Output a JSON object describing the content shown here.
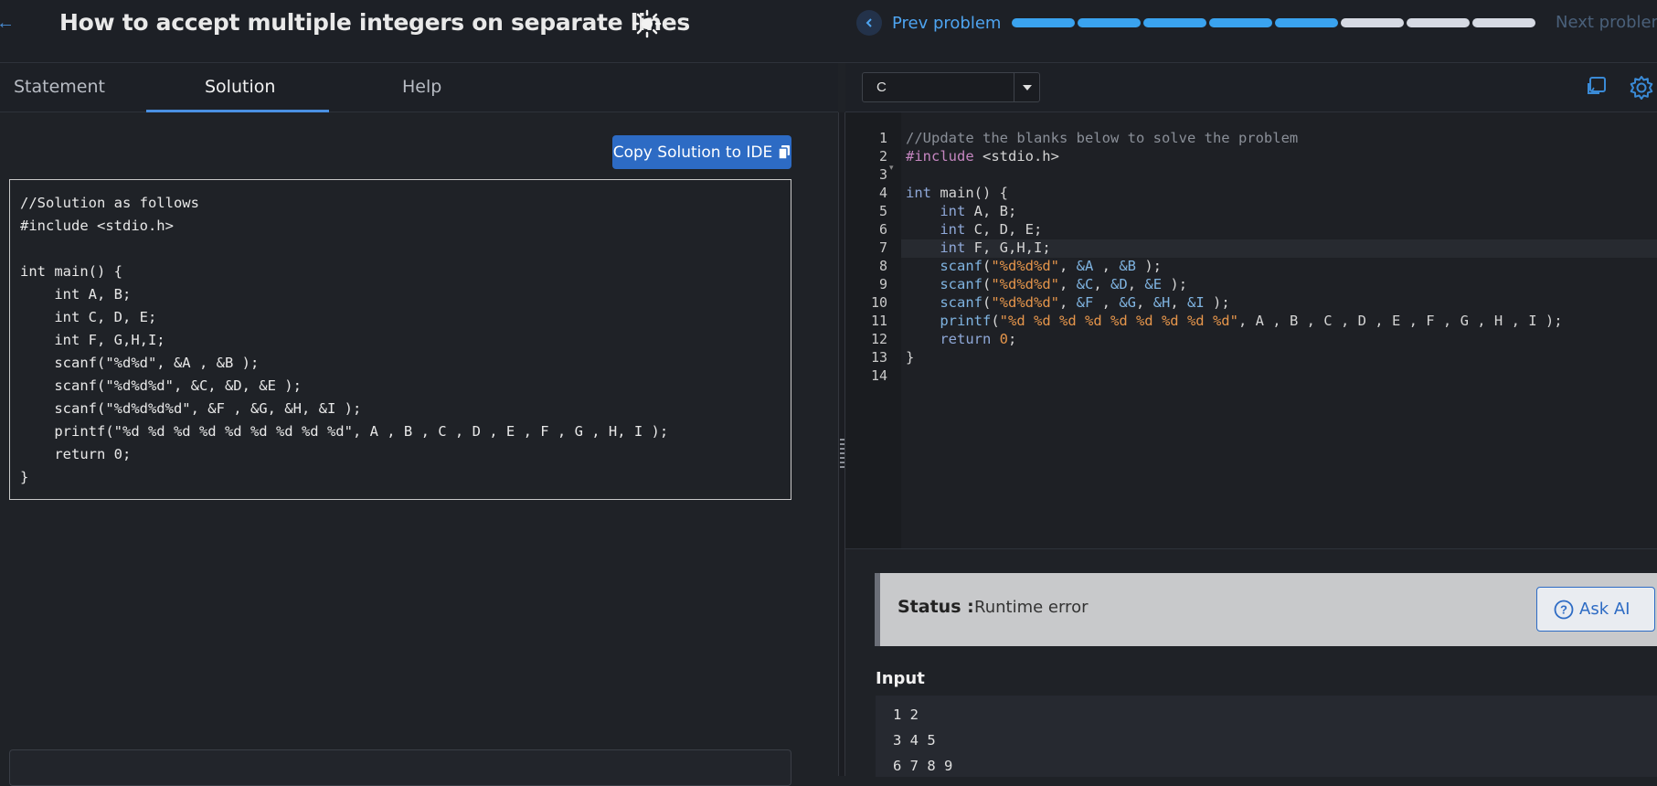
{
  "header": {
    "title": "How to accept multiple integers on separate lines",
    "prev_label": "Prev problem",
    "next_label": "Next problem",
    "progress": {
      "total": 8,
      "completed": 5
    }
  },
  "tabs": [
    {
      "label": "Statement"
    },
    {
      "label": "Solution"
    },
    {
      "label": "Help"
    }
  ],
  "solution": {
    "copy_label": "Copy Solution to IDE",
    "code": "//Solution as follows\n#include <stdio.h>\n\nint main() {\n    int A, B;\n    int C, D, E;\n    int F, G,H,I;\n    scanf(\"%d%d\", &A , &B );\n    scanf(\"%d%d%d\", &C, &D, &E );\n    scanf(\"%d%d%d%d\", &F , &G, &H, &I );\n    printf(\"%d %d %d %d %d %d %d %d %d\", A , B , C , D , E , F , G , H, I );\n    return 0;\n}"
  },
  "editor": {
    "language": "C",
    "lines": [
      "//Update the blanks below to solve the problem",
      "#include <stdio.h>",
      "",
      "int main() {",
      "    int A, B;",
      "    int C, D, E;",
      "    int F, G,H,I;",
      "    scanf(\"%d%d%d\", &A , &B );",
      "    scanf(\"%d%d%d\", &C, &D, &E );",
      "    scanf(\"%d%d%d\", &F , &G, &H, &I );",
      "    printf(\"%d %d %d %d %d %d %d %d %d\", A , B , C , D , E , F , G , H , I );",
      "    return 0;",
      "}",
      ""
    ]
  },
  "result": {
    "status_label": "Status :",
    "status_value": "Runtime error",
    "ask_ai_label": "Ask AI",
    "input_heading": "Input",
    "input_lines": [
      "1 2",
      "3 4 5",
      "6 7 8 9"
    ]
  },
  "colors": {
    "accent": "#4ea4f0",
    "button": "#2d6bc4",
    "progress_done": "#3aa3ef",
    "progress_todo": "#d6dae3"
  }
}
